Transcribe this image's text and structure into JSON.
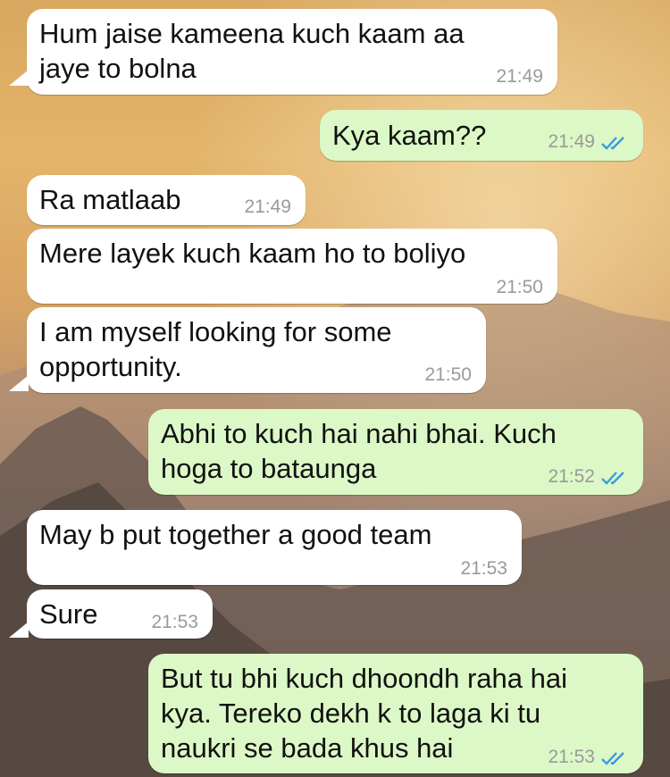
{
  "messages": [
    {
      "side": "in",
      "text": "Hum jaise kameena kuch kaam aa\njaye to bolna",
      "time": "21:49"
    },
    {
      "side": "out",
      "text": "Kya kaam??",
      "time": "21:49",
      "status": "read-double-check-icon"
    },
    {
      "side": "in",
      "text": "Ra matlaab",
      "time": "21:49"
    },
    {
      "side": "in",
      "text": "Mere layek kuch kaam ho to boliyo",
      "time": "21:50"
    },
    {
      "side": "in",
      "text": "I am myself looking for some\nopportunity.",
      "time": "21:50"
    },
    {
      "side": "out",
      "text": "Abhi to kuch hai nahi bhai. Kuch\nhoga to bataunga",
      "time": "21:52",
      "status": "read-double-check-icon"
    },
    {
      "side": "in",
      "text": "May b put together a good team",
      "time": "21:53"
    },
    {
      "side": "in",
      "text": "Sure",
      "time": "21:53"
    },
    {
      "side": "out",
      "text": "But tu bhi kuch dhoondh raha hai\nkya. Tereko dekh k to laga ki tu\nnaukri se bada khus hai",
      "time": "21:53",
      "status": "read-double-check-icon"
    }
  ],
  "colors": {
    "incoming_bubble": "#ffffff",
    "outgoing_bubble": "#dcf8c6",
    "read_ticks": "#3a9be0",
    "timestamp": "#9a9a9a"
  }
}
